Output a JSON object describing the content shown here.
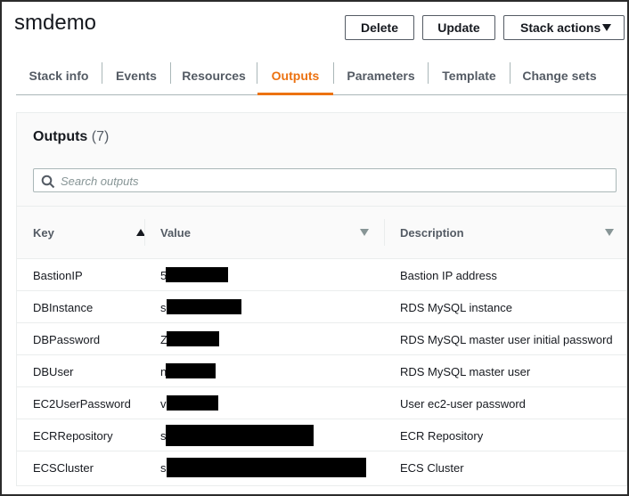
{
  "stack": {
    "name": "smdemo"
  },
  "actions": {
    "delete": "Delete",
    "update": "Update",
    "stack_actions": "Stack actions"
  },
  "tabs": [
    {
      "label": "Stack info"
    },
    {
      "label": "Events"
    },
    {
      "label": "Resources"
    },
    {
      "label": "Outputs",
      "active": true
    },
    {
      "label": "Parameters"
    },
    {
      "label": "Template"
    },
    {
      "label": "Change sets"
    }
  ],
  "outputs": {
    "title": "Outputs",
    "count": "(7)",
    "search_placeholder": "Search outputs",
    "columns": {
      "key": "Key",
      "value": "Value",
      "description": "Description"
    },
    "rows": [
      {
        "key": "BastionIP",
        "value_visible": "5",
        "description": "Bastion IP address"
      },
      {
        "key": "DBInstance",
        "value_visible": "s",
        "description": "RDS MySQL instance"
      },
      {
        "key": "DBPassword",
        "value_visible": "Z",
        "description": "RDS MySQL master user initial password"
      },
      {
        "key": "DBUser",
        "value_visible": "n",
        "description": "RDS MySQL master user"
      },
      {
        "key": "EC2UserPassword",
        "value_visible": "v",
        "description": "User ec2-user password"
      },
      {
        "key": "ECRRepository",
        "value_visible": "s",
        "description": "ECR Repository"
      },
      {
        "key": "ECSCluster",
        "value_visible": "s",
        "description": "ECS Cluster"
      }
    ]
  },
  "colors": {
    "accent": "#ec7211",
    "text": "#16191f",
    "muted": "#545b64",
    "border": "#eaeded"
  }
}
